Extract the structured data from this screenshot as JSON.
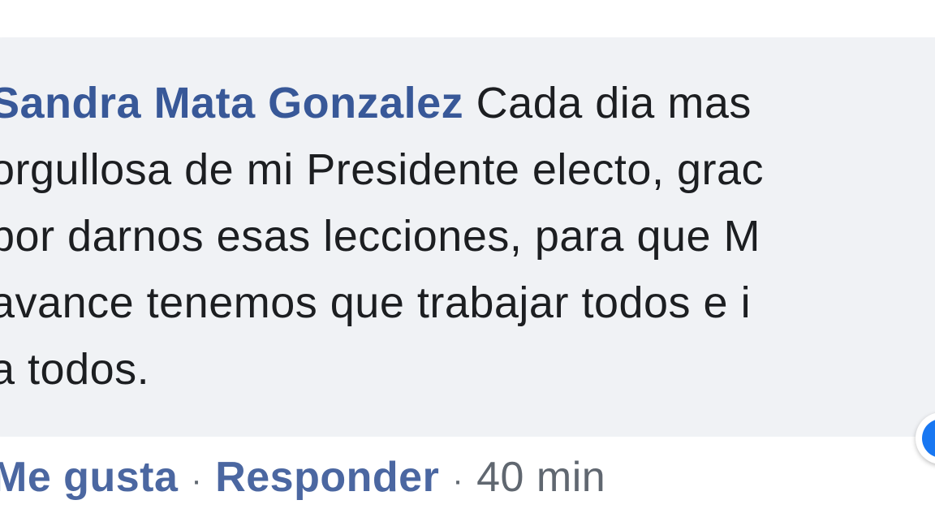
{
  "comment": {
    "author": "Sandra Mata Gonzalez",
    "text_line1": "Cada dia mas",
    "text_line2": "orgullosa de mi Presidente electo, grac",
    "text_line3": "por darnos esas lecciones, para que M",
    "text_line4": "avance tenemos que trabajar todos e i",
    "text_line5": "a todos.",
    "actions": {
      "like_label": "Me gusta",
      "separator": "·",
      "reply_label": "Responder",
      "timestamp": "40 min"
    },
    "reaction_icon": "like-reaction-icon",
    "colors": {
      "bubble_bg": "#f0f2f5",
      "author": "#385898",
      "link": "#4b67a1",
      "meta": "#606770",
      "reaction": "#1877f2"
    }
  }
}
